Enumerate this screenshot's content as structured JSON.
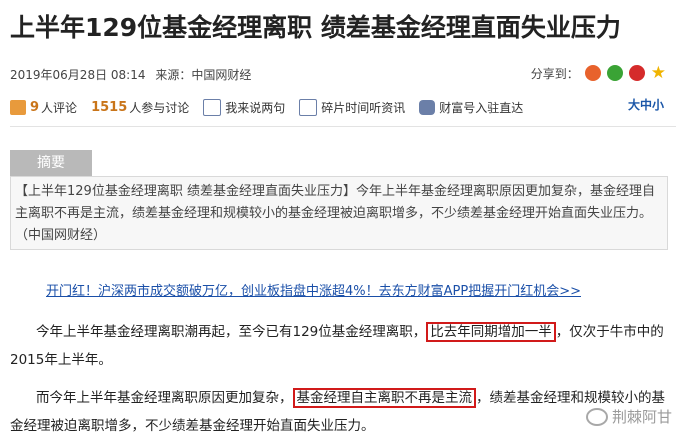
{
  "title": "上半年129位基金经理离职  绩差基金经理直面失业压力",
  "meta": {
    "datetime": "2019年06月28日  08:14",
    "source": "来源：中国网财经",
    "share_label": "分享到："
  },
  "toolbar": {
    "comments_count": "9",
    "comments_label": "人评论",
    "participants_count": "1515",
    "participants_label": "人参与讨论",
    "say_label": "我来说两句",
    "fragment_label": "碎片时间听资讯",
    "caifu_label": "财富号入驻直达",
    "fontsize_label": "大中小"
  },
  "abstract": {
    "tab_label": "摘要",
    "text": "【上半年129位基金经理离职  绩差基金经理直面失业压力】今年上半年基金经理离职原因更加复杂，基金经理自主离职不再是主流，绩差基金经理和规模较小的基金经理被迫离职增多，不少绩差基金经理开始直面失业压力。（中国网财经）"
  },
  "promo_link": "开门红！沪深两市成交额破万亿，创业板指盘中涨超4%！去东方财富APP把握开门红机会>>",
  "paragraphs": {
    "p1_a": "今年上半年基金经理离职潮再起，至今已有129位基金经理离职，",
    "p1_hl": "比去年同期增加一半",
    "p1_b": "，仅次于牛市中的2015年上半年。",
    "p2_a": "而今年上半年基金经理离职原因更加复杂，",
    "p2_hl": "基金经理自主离职不再是主流",
    "p2_b": "，绩差基金经理和规模较小的基金经理被迫离职增多，不少绩差基金经理开始直面失业压力。"
  },
  "watermark": "荆棘阿甘",
  "colors": {
    "highlight_border": "#d11a1a",
    "link": "#1a4fa8",
    "count": "#c9751a"
  }
}
